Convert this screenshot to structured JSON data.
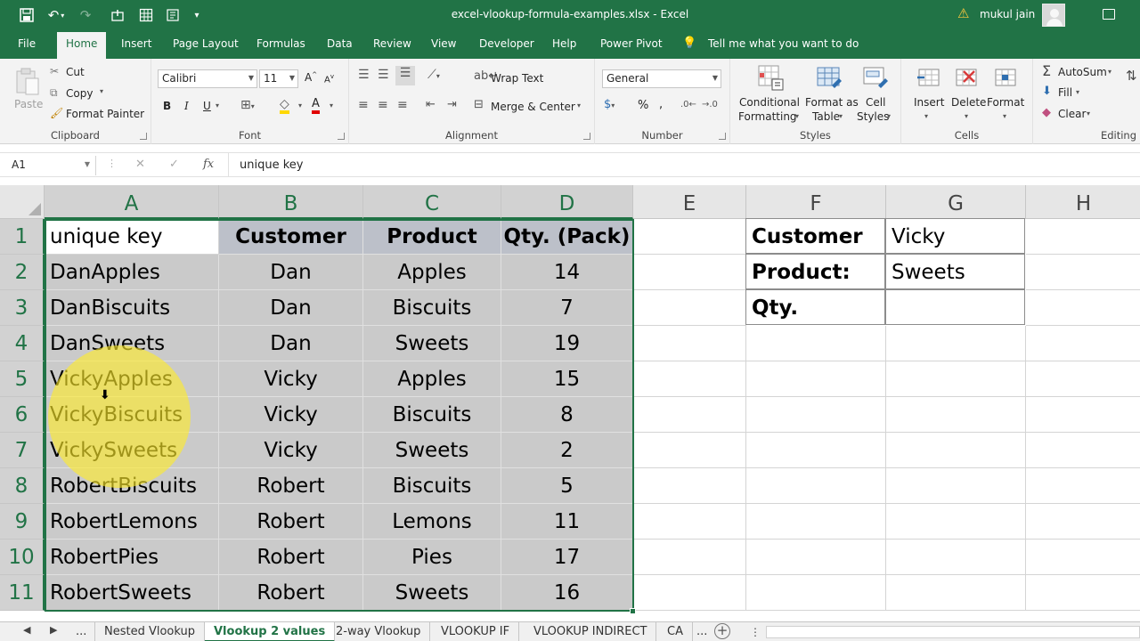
{
  "titlebar": {
    "filename": "excel-vlookup-formula-examples.xlsx",
    "separator": " - ",
    "app_name": "Excel",
    "user_name": "mukul jain"
  },
  "menu": {
    "tabs": [
      "File",
      "Home",
      "Insert",
      "Page Layout",
      "Formulas",
      "Data",
      "Review",
      "View",
      "Developer",
      "Help",
      "Power Pivot"
    ],
    "active_tab": "Home",
    "tell_me": "Tell me what you want to do"
  },
  "ribbon": {
    "clipboard": {
      "label": "Clipboard",
      "paste": "Paste",
      "cut": "Cut",
      "copy": "Copy",
      "format_painter": "Format Painter"
    },
    "font": {
      "label": "Font",
      "font_name": "Calibri",
      "font_size": "11",
      "bold": "B",
      "italic": "I",
      "underline": "U"
    },
    "alignment": {
      "label": "Alignment",
      "wrap_text": "Wrap Text",
      "merge_center": "Merge & Center"
    },
    "number": {
      "label": "Number",
      "format": "General",
      "percent": "%"
    },
    "styles": {
      "label": "Styles",
      "conditional_formatting_1": "Conditional",
      "conditional_formatting_2": "Formatting",
      "format_as_table_1": "Format as",
      "format_as_table_2": "Table",
      "cell_styles_1": "Cell",
      "cell_styles_2": "Styles"
    },
    "cells": {
      "label": "Cells",
      "insert": "Insert",
      "delete": "Delete",
      "format": "Format"
    },
    "editing": {
      "label": "Editing",
      "autosum": "AutoSum",
      "fill": "Fill",
      "clear": "Clear"
    }
  },
  "formula_bar": {
    "name_box": "A1",
    "fx": "fx",
    "content": "unique key"
  },
  "grid": {
    "columns": [
      "A",
      "B",
      "C",
      "D",
      "E",
      "F",
      "G",
      "H"
    ],
    "rows": [
      "1",
      "2",
      "3",
      "4",
      "5",
      "6",
      "7",
      "8",
      "9",
      "10",
      "11"
    ],
    "table": {
      "headers": [
        "unique key",
        "Customer",
        "Product",
        "Qty. (Pack)"
      ],
      "rows": [
        [
          "DanApples",
          "Dan",
          "Apples",
          "14"
        ],
        [
          "DanBiscuits",
          "Dan",
          "Biscuits",
          "7"
        ],
        [
          "DanSweets",
          "Dan",
          "Sweets",
          "19"
        ],
        [
          "VickyApples",
          "Vicky",
          "Apples",
          "15"
        ],
        [
          "VickyBiscuits",
          "Vicky",
          "Biscuits",
          "8"
        ],
        [
          "VickySweets",
          "Vicky",
          "Sweets",
          "2"
        ],
        [
          "RobertBiscuits",
          "Robert",
          "Biscuits",
          "5"
        ],
        [
          "RobertLemons",
          "Robert",
          "Lemons",
          "11"
        ],
        [
          "RobertPies",
          "Robert",
          "Pies",
          "17"
        ],
        [
          "RobertSweets",
          "Robert",
          "Sweets",
          "16"
        ]
      ]
    },
    "lookup": {
      "labels": [
        "Customer",
        "Product:",
        "Qty."
      ],
      "values": [
        "Vicky",
        "Sweets",
        ""
      ]
    }
  },
  "sheet_tabs": {
    "ellipsis": "...",
    "tabs": [
      "Nested Vlookup",
      "Vlookup 2 values",
      "2-way Vlookup",
      "VLOOKUP IF",
      "VLOOKUP INDIRECT",
      "CA"
    ],
    "active": "Vlookup 2 values"
  },
  "colors": {
    "excel_green": "#217346",
    "selection_gray": "#cacaca",
    "header_row_fill": "#bcc0c9",
    "highlight_yellow": "#ffec28"
  }
}
